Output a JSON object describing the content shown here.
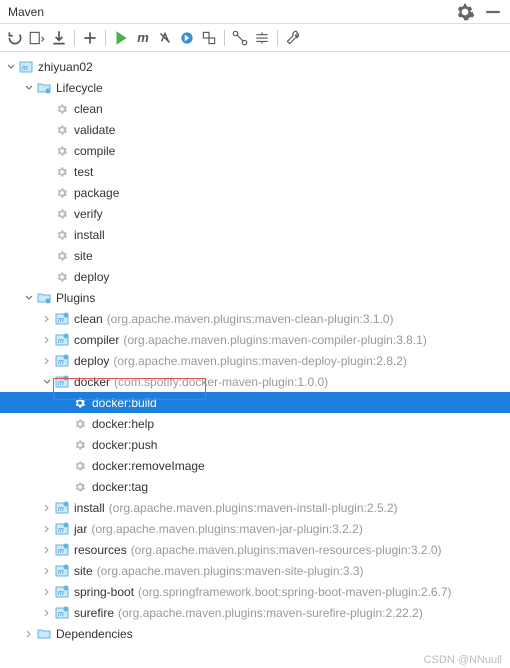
{
  "title": "Maven",
  "project": "zhiyuan02",
  "lifecycle": {
    "label": "Lifecycle",
    "items": [
      "clean",
      "validate",
      "compile",
      "test",
      "package",
      "verify",
      "install",
      "site",
      "deploy"
    ]
  },
  "plugins": {
    "label": "Plugins",
    "items": [
      {
        "name": "clean",
        "coord": "(org.apache.maven.plugins:maven-clean-plugin:3.1.0)",
        "expanded": false
      },
      {
        "name": "compiler",
        "coord": "(org.apache.maven.plugins:maven-compiler-plugin:3.8.1)",
        "expanded": false
      },
      {
        "name": "deploy",
        "coord": "(org.apache.maven.plugins:maven-deploy-plugin:2.8.2)",
        "expanded": false
      },
      {
        "name": "docker",
        "coord": "(com.spotify:docker-maven-plugin:1.0.0)",
        "expanded": true,
        "goals": [
          "docker:build",
          "docker:help",
          "docker:push",
          "docker:removeImage",
          "docker:tag"
        ]
      },
      {
        "name": "install",
        "coord": "(org.apache.maven.plugins:maven-install-plugin:2.5.2)",
        "expanded": false
      },
      {
        "name": "jar",
        "coord": "(org.apache.maven.plugins:maven-jar-plugin:3.2.2)",
        "expanded": false
      },
      {
        "name": "resources",
        "coord": "(org.apache.maven.plugins:maven-resources-plugin:3.2.0)",
        "expanded": false
      },
      {
        "name": "site",
        "coord": "(org.apache.maven.plugins:maven-site-plugin:3.3)",
        "expanded": false
      },
      {
        "name": "spring-boot",
        "coord": "(org.springframework.boot:spring-boot-maven-plugin:2.6.7)",
        "expanded": false
      },
      {
        "name": "surefire",
        "coord": "(org.apache.maven.plugins:maven-surefire-plugin:2.22.2)",
        "expanded": false
      }
    ]
  },
  "dependencies": "Dependencies",
  "selected_goal": "docker:build",
  "watermark": "CSDN @NNuull"
}
